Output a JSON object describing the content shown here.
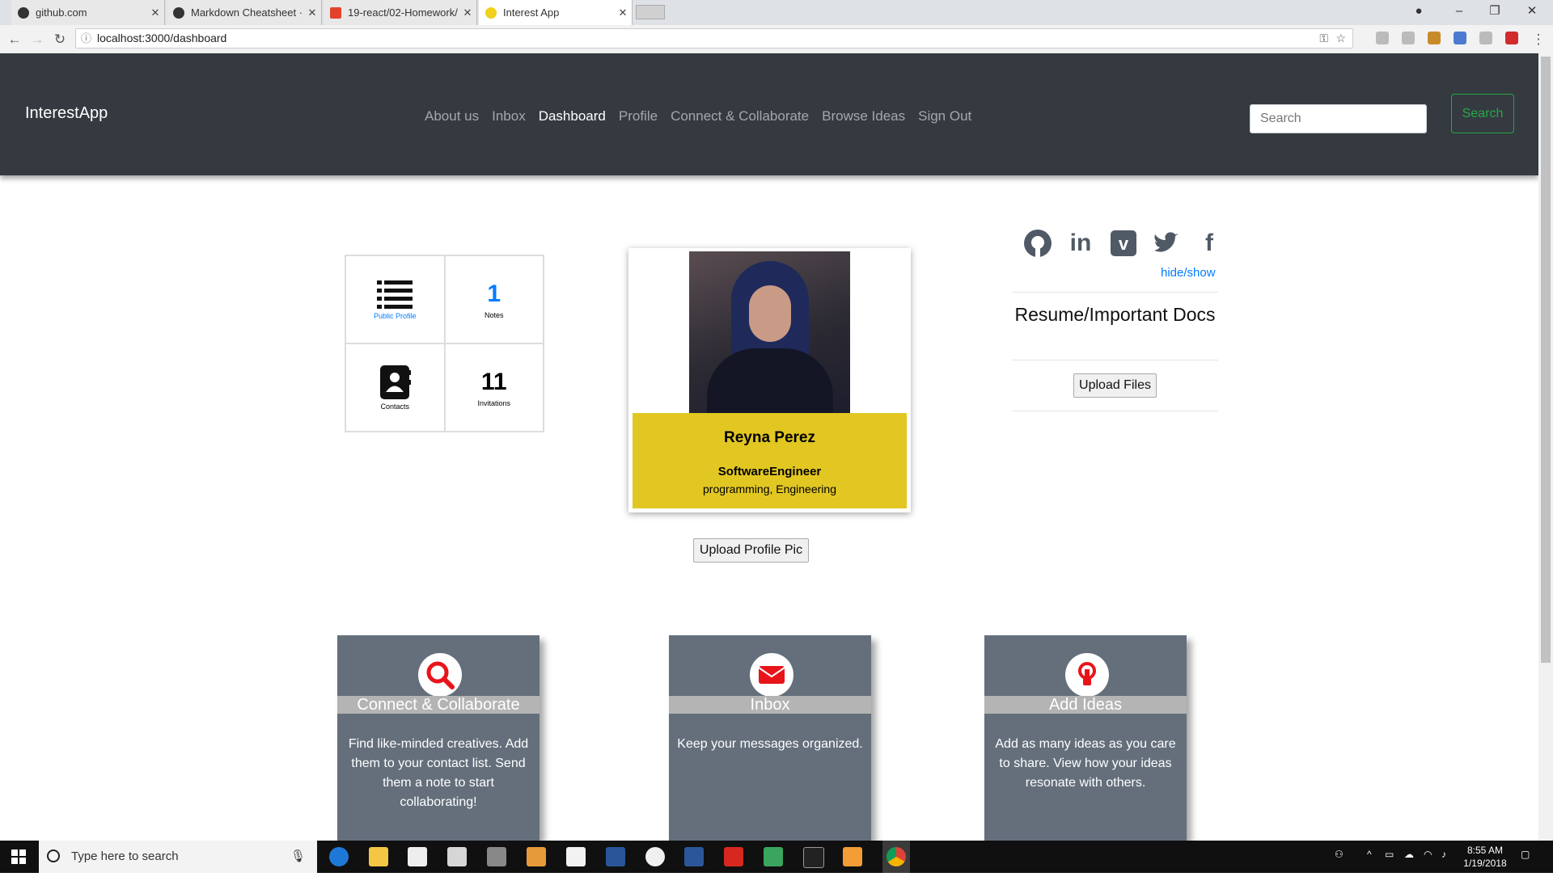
{
  "browser": {
    "tabs": [
      {
        "title": "github.com",
        "active": false
      },
      {
        "title": "Markdown Cheatsheet · ",
        "active": false
      },
      {
        "title": "19-react/02-Homework/",
        "active": false
      },
      {
        "title": "Interest App",
        "active": true
      }
    ],
    "url": "localhost:3000/dashboard"
  },
  "navbar": {
    "brand": "InterestApp",
    "links": [
      {
        "label": "About us",
        "active": false
      },
      {
        "label": "Inbox",
        "active": false
      },
      {
        "label": "Dashboard",
        "active": true
      },
      {
        "label": "Profile",
        "active": false
      },
      {
        "label": "Connect & Collaborate",
        "active": false
      },
      {
        "label": "Browse Ideas",
        "active": false
      },
      {
        "label": "Sign Out",
        "active": false
      }
    ],
    "search_placeholder": "Search",
    "search_button": "Search"
  },
  "stats": {
    "public_profile_label": "Public Profile",
    "notes_count": "1",
    "notes_label": "Notes",
    "contacts_label": "Contacts",
    "invitations_count": "11",
    "invitations_label": "Invitations"
  },
  "profile": {
    "name": "Reyna Perez",
    "title": "SoftwareEngineer",
    "tags": "programming, Engineering",
    "upload_pic_button": "Upload Profile Pic"
  },
  "social": {
    "icons": [
      "github-icon",
      "linkedin-icon",
      "vimeo-icon",
      "twitter-icon",
      "facebook-icon"
    ],
    "hide_show": "hide/show"
  },
  "resume": {
    "heading": "Resume/Important Docs",
    "upload_button": "Upload Files"
  },
  "features": [
    {
      "title": "Connect & Collaborate",
      "icon": "search-icon",
      "desc": "Find like-minded creatives. Add them to your contact list. Send them a note to start collaborating!"
    },
    {
      "title": "Inbox",
      "icon": "envelope-icon",
      "desc": "Keep your messages organized."
    },
    {
      "title": "Add Ideas",
      "icon": "lightbulb-icon",
      "desc": "Add as many ideas as you care to share. View how your ideas resonate with others."
    }
  ],
  "taskbar": {
    "search_placeholder": "Type here to search",
    "time": "8:55 AM",
    "date": "1/19/2018"
  },
  "colors": {
    "navbar_bg": "#343a40",
    "profile_band": "#e2c722",
    "feature_bg": "#646f7b",
    "accent_red": "#e8141a",
    "link_blue": "#007bff",
    "search_green": "#28a745"
  }
}
